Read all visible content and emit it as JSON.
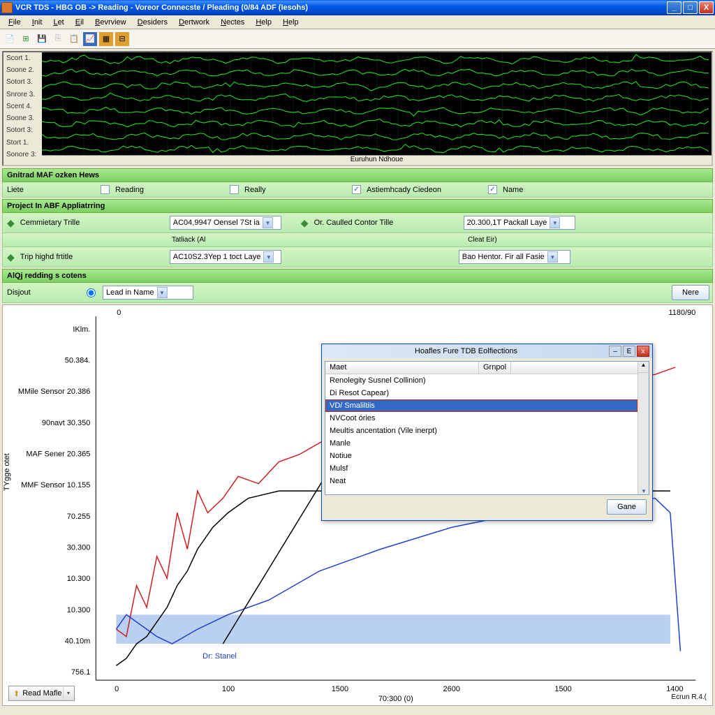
{
  "window": {
    "title": "VCR TDS - HBG OB -> Reading - Voreor Connecste / Pleading (0/84 ADF (Iesohs)"
  },
  "menu": [
    "File",
    "Init",
    "Let",
    "Eil",
    "Bevrview",
    "Desiders",
    "Dertwork",
    "Nectes",
    "Help",
    "Help"
  ],
  "sig_labels": [
    "Scort 1.",
    "Soone 2.",
    "Sotort 3.",
    "Snrore 3.",
    "Scent 4.",
    "Soone 3.",
    "Sotort 3:",
    "Stort 1.",
    "Sonore 3:"
  ],
  "sig_footer": "Euruhun Ndhoue",
  "section1": {
    "title": "Gnitrad MAF ozken Hews",
    "lite": "Liete",
    "reading": "Reading",
    "really": "Really",
    "astern": "Astiemhcady Ciedeon",
    "name": "Name"
  },
  "section2": {
    "title": "Project In ABF Appliatrring",
    "r1_label": "Cemmietary Trille",
    "r1_combo": "AC04,9947 Oensel 7St ia",
    "r1_sub": "Tatliack (Al",
    "r1_right_label": "Or. Caulled Contor Tille",
    "r1_right_combo": "20.300,1T Packall Laye",
    "r1_right_sub": "Cleat Eir)",
    "r2_label": "Trip highd frtitle",
    "r2_combo": "AC10S2.3Yep 1 toct Laye",
    "r2_right_combo": "Bao Hentor. Fir all Fasie"
  },
  "section3": {
    "title": "AlQj redding s cotens",
    "disjout": "Disjout",
    "combo": "Lead in Name",
    "nere": "Nere"
  },
  "popup": {
    "title": "Hoafles Fure TDB Eolfiections",
    "col1": "Maet",
    "col2": "Grnpol",
    "items": [
      "Renolegity Susnel Collinion)",
      "Di Resot Capear)",
      "VD/ Smaliltiis",
      "NVCoot óries",
      "Meultis ancentation (Vile inerpt)",
      "Manle",
      "Notiue",
      "Mulsf",
      "Neat"
    ],
    "selected_index": 2,
    "save": "Gane"
  },
  "chart": {
    "ylabel": "TYgge otet",
    "xlabel": "70:300 (0)",
    "top_left": "0",
    "top_right": "1180/90",
    "read_btn": "Read Mafle",
    "right_footer": "Ecrun R.4.(",
    "yticks": [
      "IKlm.",
      "50.384.",
      "MMile Sensor 20.386",
      "90navt 30.350",
      "MAF Sener 20.365",
      "MMF Sensor 10.155",
      "70.255",
      "30.300",
      "10.300",
      "10.300",
      "40.10m",
      "756.1"
    ],
    "xticks": [
      "0",
      "100",
      "1500",
      "2600",
      "1500",
      "1400"
    ],
    "annotation": "Dr: Stanel"
  },
  "chart_data": {
    "type": "line",
    "title": "",
    "xlabel": "70:300 (0)",
    "ylabel": "TYgge otet",
    "xlim": [
      0,
      1180
    ],
    "ylim": [
      5,
      55
    ],
    "series": [
      {
        "name": "red",
        "color": "#d02020",
        "x": [
          40,
          60,
          80,
          100,
          120,
          140,
          160,
          180,
          200,
          220,
          250,
          280,
          320,
          360,
          400,
          450,
          520,
          600,
          700,
          800,
          900,
          1000,
          1100,
          1140
        ],
        "y": [
          12,
          11,
          18,
          15,
          22,
          19,
          28,
          23,
          31,
          28,
          30,
          33,
          32,
          35,
          36,
          38,
          39,
          41,
          42,
          44,
          45,
          46,
          47,
          48
        ]
      },
      {
        "name": "blue",
        "color": "#2040d0",
        "x": [
          40,
          60,
          80,
          100,
          120,
          150,
          200,
          260,
          340,
          440,
          560,
          700,
          840,
          980,
          1100,
          1130,
          1150
        ],
        "y": [
          12,
          14,
          13,
          12,
          11,
          10,
          12,
          14,
          16,
          20,
          23,
          26,
          28,
          29,
          30,
          28,
          9
        ]
      },
      {
        "name": "black",
        "color": "#000",
        "x": [
          40,
          60,
          80,
          100,
          120,
          140,
          160,
          180,
          200,
          230,
          260,
          300,
          360,
          460,
          1130
        ],
        "y": [
          7,
          8,
          10,
          11,
          13,
          15,
          18,
          20,
          23,
          26,
          28,
          30,
          31,
          31,
          31
        ]
      },
      {
        "name": "blue-fill",
        "color": "#8cb0e8",
        "x": [
          40,
          1130
        ],
        "y": [
          12,
          12
        ]
      }
    ]
  }
}
